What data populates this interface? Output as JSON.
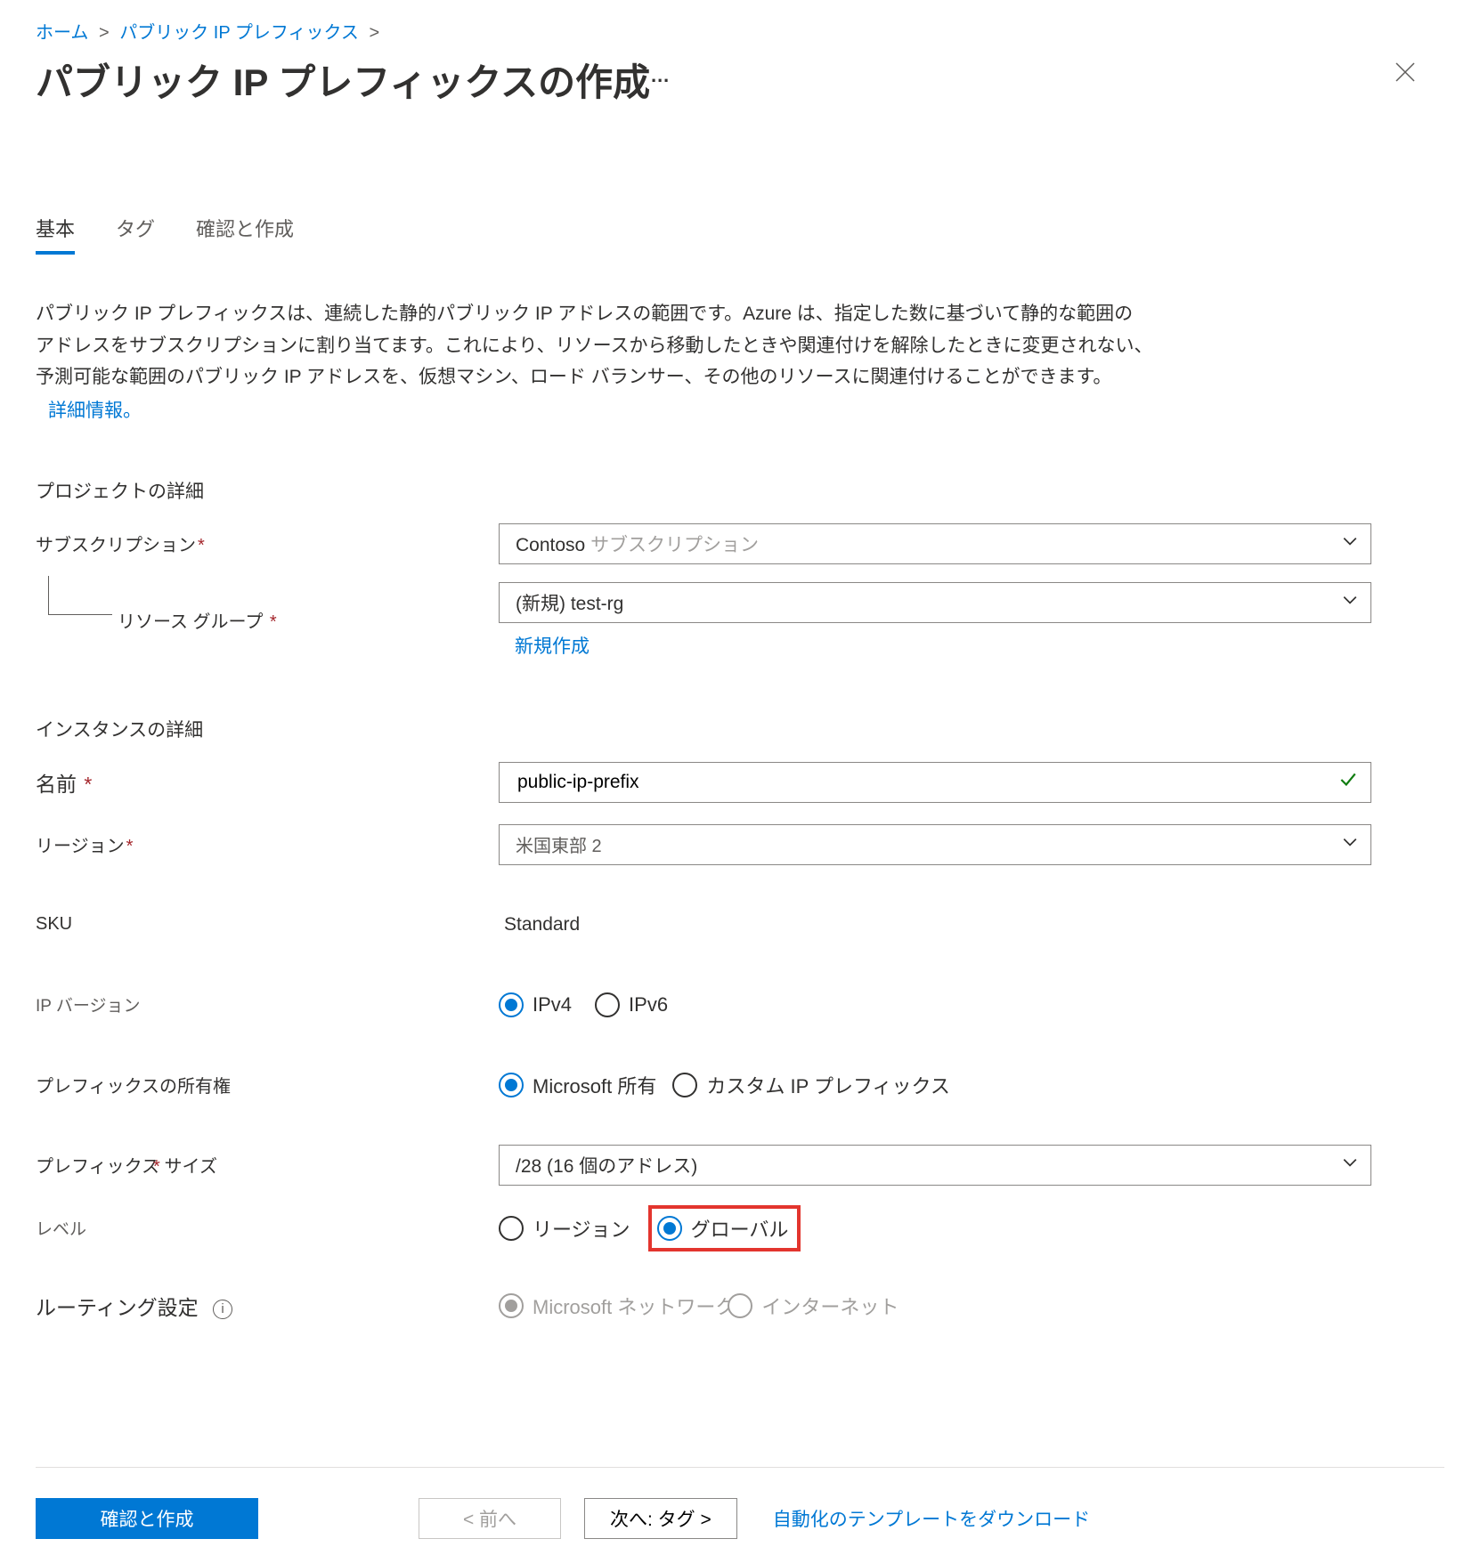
{
  "breadcrumb": {
    "home": "ホーム",
    "sep": ">",
    "prefixes": "パブリック IP プレフィックス"
  },
  "header": {
    "title": "パブリック IP プレフィックスの作成",
    "ellipsis": "…"
  },
  "tabs": {
    "basics": "基本",
    "tags": "タグ",
    "review": "確認と作成"
  },
  "description": {
    "line1": "パブリック IP プレフィックスは、連続した静的パブリック IP アドレスの範囲です。Azure は、指定した数に基づいて静的な範囲の",
    "line2": "アドレスをサブスクリプションに割り当てます。これにより、リソースから移動したときや関連付けを解除したときに変更されない、",
    "line3": "予測可能な範囲のパブリック IP アドレスを、仮想マシン、ロード バランサー、その他のリソースに関連付けることができます。",
    "learn": "詳細情報。"
  },
  "sections": {
    "project": "プロジェクトの詳細",
    "instance": "インスタンスの詳細"
  },
  "labels": {
    "subscription": "サブスクリプション",
    "resource_group": "リソース グループ",
    "name": "名前",
    "region": "リージョン",
    "sku": "SKU",
    "ip_version": "IP バージョン",
    "ownership": "プレフィックスの所有権",
    "prefix_size": "プレフィックス サイズ",
    "level": "レベル",
    "routing": "ルーティング設定"
  },
  "values": {
    "subscription_main": "Contoso ",
    "subscription_sub": "サブスクリプション",
    "resource_group": "(新規) test-rg",
    "create_new": "新規作成",
    "name": "public-ip-prefix",
    "region": "米国東部 2",
    "sku": "Standard",
    "ipv4": "IPv4",
    "ipv6": "IPv6",
    "ms_owned": "Microsoft 所有",
    "custom_prefix": "カスタム IP プレフィックス",
    "prefix_size": "/28 (16 個のアドレス)",
    "level_region": "リージョン",
    "level_global": "グローバル",
    "routing_ms": "Microsoft ネットワーク",
    "routing_internet": "インターネット"
  },
  "footer": {
    "review_create": "確認と作成",
    "prev": "< 前へ",
    "next": "次へ: タグ >",
    "download": "自動化のテンプレートをダウンロード"
  }
}
